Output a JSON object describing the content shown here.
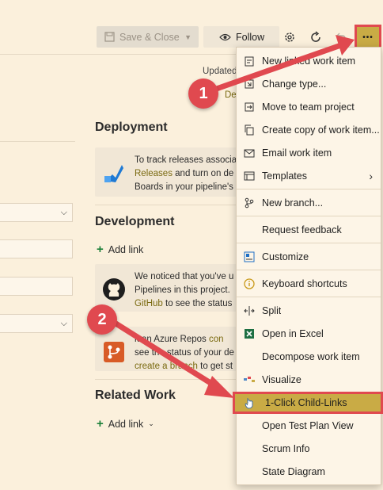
{
  "toolbar": {
    "save_close_label": "Save & Close",
    "follow_label": "Follow",
    "more_label": "•••"
  },
  "header": {
    "updated_text": "Updated",
    "updated_link": "De"
  },
  "deployment": {
    "title": "Deployment",
    "lines": [
      "To track releases associa",
      "and turn on de",
      "Boards in your pipeline's"
    ],
    "releases_link": "Releases"
  },
  "development": {
    "title": "Development",
    "add_link": "Add link",
    "github_lines": [
      "We noticed that you've u",
      "Pipelines in this project.",
      "to see the status"
    ],
    "github_link": "GitHub",
    "repos_lines": [
      "k an Azure Repos",
      "see the status of your de"
    ],
    "repos_link1": "con",
    "repos_link2": "create a branch",
    "repos_tail": "to get st"
  },
  "related": {
    "title": "Related Work",
    "add_link": "Add link"
  },
  "menu": {
    "items": [
      {
        "label": "New linked work item",
        "icon": "linked-item-icon"
      },
      {
        "label": "Change type...",
        "icon": "change-type-icon"
      },
      {
        "label": "Move to team project",
        "icon": "move-icon"
      },
      {
        "label": "Create copy of work item...",
        "icon": "copy-icon"
      },
      {
        "label": "Email work item",
        "icon": "email-icon"
      },
      {
        "label": "Templates",
        "icon": "templates-icon"
      },
      {
        "label": "New branch...",
        "icon": "branch-icon"
      },
      {
        "label": "Request feedback",
        "icon": ""
      },
      {
        "label": "Customize",
        "icon": "customize-icon"
      },
      {
        "label": "Keyboard shortcuts",
        "icon": "info-icon"
      },
      {
        "label": "Split",
        "icon": "split-icon"
      },
      {
        "label": "Open in Excel",
        "icon": "excel-icon"
      },
      {
        "label": "Decompose work item",
        "icon": ""
      },
      {
        "label": "Visualize",
        "icon": "visualize-icon"
      },
      {
        "label": "1-Click Child-Links",
        "icon": "hand-icon"
      },
      {
        "label": "Open Test Plan View",
        "icon": ""
      },
      {
        "label": "Scrum Info",
        "icon": ""
      },
      {
        "label": "State Diagram",
        "icon": ""
      }
    ]
  },
  "annotations": {
    "badge1": "1",
    "badge2": "2"
  },
  "colors": {
    "accent": "#c9ab45",
    "callout": "#e0494f",
    "background": "#fbf0dc"
  }
}
